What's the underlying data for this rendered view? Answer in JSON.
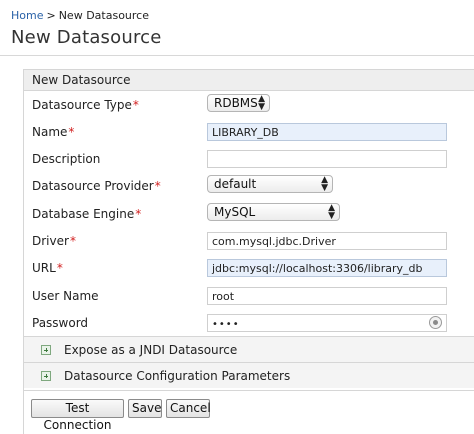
{
  "breadcrumb": {
    "home": "Home",
    "separator": ">",
    "current": "New Datasource"
  },
  "page": {
    "title": "New Datasource"
  },
  "panel": {
    "header": "New Datasource"
  },
  "fields": {
    "datasource_type": {
      "label": "Datasource Type",
      "value": "RDBMS"
    },
    "name": {
      "label": "Name",
      "value": "LIBRARY_DB"
    },
    "description": {
      "label": "Description",
      "value": ""
    },
    "datasource_provider": {
      "label": "Datasource Provider",
      "value": "default"
    },
    "database_engine": {
      "label": "Database Engine",
      "value": "MySQL"
    },
    "driver": {
      "label": "Driver",
      "value": "com.mysql.jdbc.Driver"
    },
    "url": {
      "label": "URL",
      "value": "jdbc:mysql://localhost:3306/library_db"
    },
    "user_name": {
      "label": "User Name",
      "value": "root"
    },
    "password": {
      "label": "Password",
      "value": "••••"
    }
  },
  "required_marker": "*",
  "sections": {
    "jndi": "Expose as a JNDI Datasource",
    "config": "Datasource Configuration Parameters"
  },
  "buttons": {
    "test_connection": "Test Connection",
    "save": "Save",
    "cancel": "Cancel"
  },
  "icons": {
    "select_arrows": "up-down-arrows-icon",
    "expand": "plus-icon",
    "password_reveal": "eye-icon"
  },
  "colors": {
    "link": "#2a62a8",
    "required": "#d21f1f",
    "autofill": "#e8f0fb"
  }
}
